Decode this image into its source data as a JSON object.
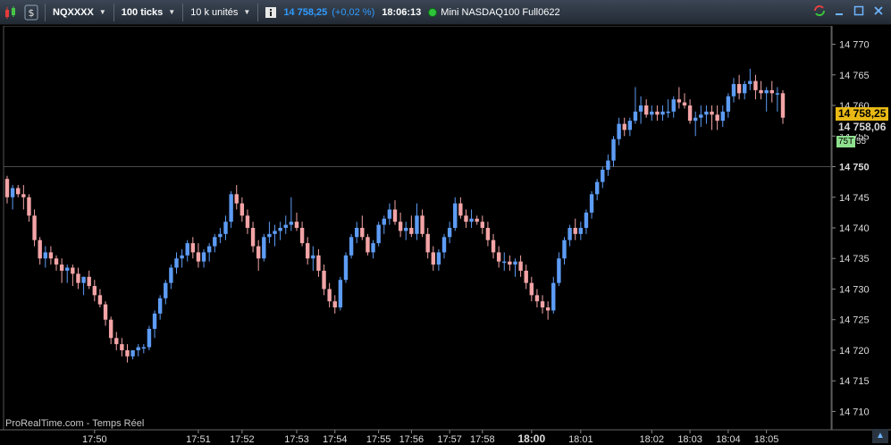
{
  "toolbar": {
    "symbol": "NQXXXX",
    "interval": "100 ticks",
    "units": "10 k unités",
    "price": "14 758,25",
    "change": "(+0,02 %)",
    "time": "18:06:13",
    "description": "Mini NASDAQ100 Full0622"
  },
  "chart_data": {
    "type": "candlestick",
    "y_ticks": [
      "14 770",
      "14 765",
      "14 760",
      "14 755",
      "14 750",
      "14 745",
      "14 740",
      "14 735",
      "14 730",
      "14 725",
      "14 720",
      "14 715",
      "14 710"
    ],
    "y_tick_values": [
      14770,
      14765,
      14760,
      14755,
      14750,
      14745,
      14740,
      14735,
      14730,
      14725,
      14720,
      14715,
      14710
    ],
    "ylim": [
      14707,
      14773
    ],
    "x_labels": [
      {
        "label": "17:50",
        "bar": 16,
        "bold": false
      },
      {
        "label": "17:51",
        "bar": 35,
        "bold": false
      },
      {
        "label": "17:52",
        "bar": 43,
        "bold": false
      },
      {
        "label": "17:53",
        "bar": 53,
        "bold": false
      },
      {
        "label": "17:54",
        "bar": 60,
        "bold": false
      },
      {
        "label": "17:55",
        "bar": 68,
        "bold": false
      },
      {
        "label": "17:56",
        "bar": 74,
        "bold": false
      },
      {
        "label": "17:57",
        "bar": 81,
        "bold": false
      },
      {
        "label": "17:58",
        "bar": 87,
        "bold": false
      },
      {
        "label": "18:00",
        "bar": 96,
        "bold": true
      },
      {
        "label": "18:01",
        "bar": 105,
        "bold": false
      },
      {
        "label": "18:02",
        "bar": 118,
        "bold": false
      },
      {
        "label": "18:03",
        "bar": 125,
        "bold": false
      },
      {
        "label": "18:04",
        "bar": 132,
        "bold": false
      },
      {
        "label": "18:05",
        "bar": 139,
        "bold": false
      }
    ],
    "horizontal_line": 14750,
    "candles": [
      [
        14748.0,
        14748.5,
        14744.0,
        14745.0
      ],
      [
        14745.0,
        14747.0,
        14743.0,
        14746.5
      ],
      [
        14746.5,
        14747.0,
        14745.0,
        14745.5
      ],
      [
        14745.5,
        14747.0,
        14743.0,
        14745.0
      ],
      [
        14745.0,
        14745.5,
        14741.0,
        14742.0
      ],
      [
        14742.0,
        14743.0,
        14737.0,
        14738.0
      ],
      [
        14738.0,
        14738.5,
        14734.0,
        14735.0
      ],
      [
        14735.0,
        14737.0,
        14733.5,
        14736.0
      ],
      [
        14736.0,
        14737.0,
        14734.0,
        14735.0
      ],
      [
        14735.0,
        14735.5,
        14733.0,
        14734.0
      ],
      [
        14734.0,
        14735.0,
        14731.0,
        14733.0
      ],
      [
        14733.0,
        14734.0,
        14731.0,
        14733.5
      ],
      [
        14733.5,
        14734.0,
        14730.5,
        14732.5
      ],
      [
        14732.5,
        14733.5,
        14730.0,
        14731.0
      ],
      [
        14731.0,
        14732.0,
        14729.0,
        14732.0
      ],
      [
        14732.0,
        14733.0,
        14730.0,
        14730.5
      ],
      [
        14730.5,
        14731.5,
        14728.0,
        14729.0
      ],
      [
        14729.0,
        14730.0,
        14727.0,
        14727.5
      ],
      [
        14727.5,
        14728.0,
        14724.0,
        14725.0
      ],
      [
        14725.0,
        14725.5,
        14721.0,
        14722.0
      ],
      [
        14722.0,
        14723.0,
        14720.0,
        14721.0
      ],
      [
        14721.0,
        14722.0,
        14719.0,
        14720.0
      ],
      [
        14720.0,
        14721.0,
        14718.0,
        14719.0
      ],
      [
        14719.0,
        14720.0,
        14718.5,
        14720.0
      ],
      [
        14720.0,
        14721.0,
        14719.0,
        14720.5
      ],
      [
        14720.5,
        14721.0,
        14719.5,
        14720.5
      ],
      [
        14720.5,
        14724.0,
        14720.0,
        14723.5
      ],
      [
        14723.5,
        14726.5,
        14722.0,
        14726.0
      ],
      [
        14726.0,
        14729.0,
        14725.0,
        14728.5
      ],
      [
        14728.5,
        14731.5,
        14727.5,
        14731.0
      ],
      [
        14731.0,
        14734.0,
        14730.0,
        14733.5
      ],
      [
        14733.5,
        14736.0,
        14732.5,
        14735.0
      ],
      [
        14735.0,
        14736.5,
        14733.5,
        14735.5
      ],
      [
        14735.5,
        14738.0,
        14734.5,
        14737.5
      ],
      [
        14737.5,
        14738.5,
        14735.0,
        14736.0
      ],
      [
        14736.0,
        14737.5,
        14733.5,
        14734.5
      ],
      [
        14734.5,
        14736.5,
        14733.5,
        14736.0
      ],
      [
        14736.0,
        14737.5,
        14734.5,
        14737.0
      ],
      [
        14737.0,
        14739.0,
        14736.0,
        14738.5
      ],
      [
        14738.5,
        14740.0,
        14737.5,
        14739.0
      ],
      [
        14739.0,
        14742.0,
        14738.0,
        14741.0
      ],
      [
        14741.0,
        14746.0,
        14740.0,
        14745.5
      ],
      [
        14745.5,
        14747.0,
        14743.0,
        14744.0
      ],
      [
        14744.0,
        14745.0,
        14741.0,
        14742.0
      ],
      [
        14742.0,
        14743.0,
        14739.0,
        14740.0
      ],
      [
        14740.0,
        14741.0,
        14736.0,
        14737.0
      ],
      [
        14737.0,
        14738.0,
        14733.0,
        14735.0
      ],
      [
        14735.0,
        14739.0,
        14734.5,
        14738.5
      ],
      [
        14738.5,
        14741.0,
        14737.5,
        14739.0
      ],
      [
        14739.0,
        14740.5,
        14737.0,
        14739.5
      ],
      [
        14739.5,
        14741.0,
        14738.0,
        14740.0
      ],
      [
        14740.0,
        14742.0,
        14739.0,
        14740.5
      ],
      [
        14740.5,
        14745.0,
        14739.5,
        14741.0
      ],
      [
        14741.0,
        14742.5,
        14739.5,
        14740.0
      ],
      [
        14740.0,
        14741.0,
        14737.0,
        14737.5
      ],
      [
        14737.5,
        14738.5,
        14734.0,
        14735.0
      ],
      [
        14735.0,
        14737.0,
        14733.0,
        14735.5
      ],
      [
        14735.5,
        14736.5,
        14732.0,
        14733.0
      ],
      [
        14733.0,
        14734.0,
        14729.0,
        14730.0
      ],
      [
        14730.0,
        14731.0,
        14727.0,
        14728.0
      ],
      [
        14728.0,
        14729.0,
        14726.0,
        14727.0
      ],
      [
        14727.0,
        14732.0,
        14726.5,
        14731.5
      ],
      [
        14731.5,
        14736.0,
        14731.0,
        14735.5
      ],
      [
        14735.5,
        14739.0,
        14735.0,
        14738.5
      ],
      [
        14738.5,
        14741.0,
        14737.5,
        14740.0
      ],
      [
        14740.0,
        14742.0,
        14738.0,
        14738.5
      ],
      [
        14738.5,
        14739.0,
        14735.5,
        14736.0
      ],
      [
        14736.0,
        14738.0,
        14735.0,
        14737.5
      ],
      [
        14737.5,
        14741.0,
        14737.0,
        14740.5
      ],
      [
        14740.5,
        14742.0,
        14739.0,
        14741.5
      ],
      [
        14741.5,
        14744.0,
        14740.5,
        14743.0
      ],
      [
        14743.0,
        14744.5,
        14740.5,
        14741.0
      ],
      [
        14741.0,
        14742.5,
        14738.5,
        14739.5
      ],
      [
        14739.5,
        14741.0,
        14738.0,
        14740.0
      ],
      [
        14740.0,
        14742.0,
        14738.5,
        14739.0
      ],
      [
        14739.0,
        14744.0,
        14738.0,
        14742.0
      ],
      [
        14742.0,
        14743.0,
        14738.5,
        14739.0
      ],
      [
        14739.0,
        14740.0,
        14735.0,
        14736.0
      ],
      [
        14736.0,
        14737.0,
        14733.0,
        14734.0
      ],
      [
        14734.0,
        14736.5,
        14733.0,
        14736.0
      ],
      [
        14736.0,
        14739.0,
        14735.0,
        14738.5
      ],
      [
        14738.5,
        14741.0,
        14737.5,
        14740.0
      ],
      [
        14740.0,
        14745.0,
        14739.5,
        14744.0
      ],
      [
        14744.0,
        14745.0,
        14741.5,
        14742.0
      ],
      [
        14742.0,
        14743.0,
        14740.0,
        14741.0
      ],
      [
        14741.0,
        14743.0,
        14740.0,
        14741.5
      ],
      [
        14741.5,
        14742.0,
        14740.5,
        14741.0
      ],
      [
        14741.0,
        14742.0,
        14739.0,
        14740.0
      ],
      [
        14740.0,
        14741.0,
        14737.0,
        14738.0
      ],
      [
        14738.0,
        14739.0,
        14735.0,
        14736.0
      ],
      [
        14736.0,
        14737.0,
        14733.5,
        14734.5
      ],
      [
        14734.5,
        14736.0,
        14733.0,
        14734.5
      ],
      [
        14734.5,
        14735.5,
        14733.0,
        14734.0
      ],
      [
        14734.0,
        14735.0,
        14732.0,
        14734.5
      ],
      [
        14734.5,
        14735.5,
        14732.0,
        14733.0
      ],
      [
        14733.0,
        14734.0,
        14730.0,
        14731.0
      ],
      [
        14731.0,
        14732.0,
        14728.0,
        14729.0
      ],
      [
        14729.0,
        14730.0,
        14727.0,
        14728.0
      ],
      [
        14728.0,
        14729.0,
        14726.0,
        14727.0
      ],
      [
        14727.0,
        14728.0,
        14725.0,
        14726.5
      ],
      [
        14726.5,
        14732.0,
        14726.0,
        14731.0
      ],
      [
        14731.0,
        14736.0,
        14730.5,
        14735.0
      ],
      [
        14735.0,
        14738.5,
        14734.0,
        14738.0
      ],
      [
        14738.0,
        14740.5,
        14737.0,
        14740.0
      ],
      [
        14740.0,
        14741.5,
        14738.0,
        14739.0
      ],
      [
        14739.0,
        14741.0,
        14738.0,
        14740.0
      ],
      [
        14740.0,
        14743.0,
        14739.0,
        14742.5
      ],
      [
        14742.5,
        14746.0,
        14741.5,
        14745.5
      ],
      [
        14745.5,
        14748.0,
        14744.5,
        14747.5
      ],
      [
        14747.5,
        14750.0,
        14746.5,
        14749.5
      ],
      [
        14749.5,
        14752.0,
        14748.5,
        14751.0
      ],
      [
        14751.0,
        14755.0,
        14750.0,
        14754.5
      ],
      [
        14754.5,
        14758.0,
        14753.5,
        14757.0
      ],
      [
        14757.0,
        14758.0,
        14755.0,
        14756.0
      ],
      [
        14756.0,
        14758.0,
        14755.0,
        14757.5
      ],
      [
        14757.5,
        14763.0,
        14757.0,
        14759.0
      ],
      [
        14759.0,
        14761.5,
        14757.0,
        14760.0
      ],
      [
        14760.0,
        14761.0,
        14758.0,
        14758.5
      ],
      [
        14758.5,
        14760.0,
        14757.5,
        14759.0
      ],
      [
        14759.0,
        14760.0,
        14757.5,
        14758.5
      ],
      [
        14758.5,
        14760.0,
        14757.5,
        14759.0
      ],
      [
        14759.0,
        14761.0,
        14758.0,
        14759.0
      ],
      [
        14759.0,
        14761.5,
        14758.0,
        14761.0
      ],
      [
        14761.0,
        14763.0,
        14759.5,
        14760.5
      ],
      [
        14760.5,
        14762.0,
        14759.5,
        14760.0
      ],
      [
        14760.0,
        14761.0,
        14757.0,
        14757.5
      ],
      [
        14757.5,
        14759.0,
        14755.0,
        14758.0
      ],
      [
        14758.0,
        14760.0,
        14756.5,
        14758.5
      ],
      [
        14758.5,
        14760.0,
        14757.0,
        14759.0
      ],
      [
        14759.0,
        14760.0,
        14756.0,
        14758.5
      ],
      [
        14758.5,
        14760.0,
        14756.0,
        14757.5
      ],
      [
        14757.5,
        14760.0,
        14756.5,
        14759.0
      ],
      [
        14759.0,
        14762.0,
        14758.0,
        14761.5
      ],
      [
        14761.5,
        14764.5,
        14760.5,
        14763.5
      ],
      [
        14763.5,
        14765.0,
        14761.0,
        14762.0
      ],
      [
        14762.0,
        14764.0,
        14761.0,
        14763.5
      ],
      [
        14763.5,
        14766.0,
        14762.5,
        14764.0
      ],
      [
        14764.0,
        14765.0,
        14761.0,
        14762.5
      ],
      [
        14762.5,
        14764.0,
        14761.0,
        14762.0
      ],
      [
        14762.0,
        14763.0,
        14759.0,
        14762.5
      ],
      [
        14762.5,
        14764.0,
        14760.5,
        14762.0
      ],
      [
        14762.0,
        14763.0,
        14759.0,
        14762.0
      ],
      [
        14762.0,
        14762.5,
        14757.0,
        14758.0
      ]
    ]
  },
  "price_axis_tags": {
    "last": "14 758,25",
    "avg": "14 758,06",
    "tag75": "75T",
    "tag75_suffix": "55"
  },
  "colors": {
    "up": "#5d9cf5",
    "down": "#f3a4a6",
    "grid": "#3c3c3c",
    "axis_text": "#dcdcdc"
  },
  "watermark": "ProRealTime.com - Temps Réel"
}
